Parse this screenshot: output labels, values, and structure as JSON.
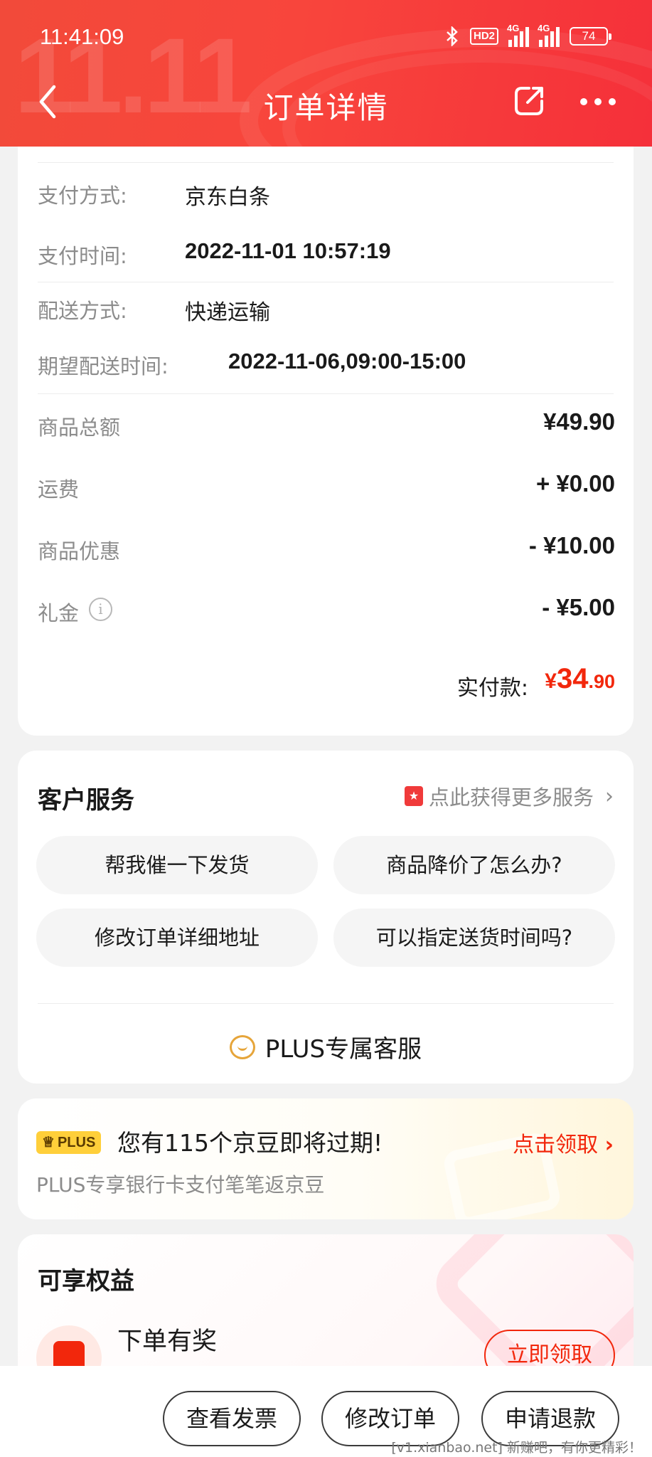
{
  "status_bar": {
    "time": "11:41:09",
    "bluetooth_icon": "bluetooth-icon",
    "hd_label": "HD2",
    "signal1_label": "4G",
    "signal2_label": "4G",
    "battery": "74"
  },
  "header": {
    "title": "订单详情",
    "decor_text": "11.11",
    "back_icon": "chevron-left-icon",
    "share_icon": "share-icon",
    "more_icon": "more-dots-icon"
  },
  "order_info": {
    "rows": [
      {
        "label": "支付方式:",
        "value": "京东白条"
      },
      {
        "label": "支付时间:",
        "value": "2022-11-01 10:57:19"
      },
      {
        "label": "配送方式:",
        "value": "快递运输"
      },
      {
        "label": "期望配送时间:",
        "value": "2022-11-06,09:00-15:00"
      }
    ],
    "amounts": [
      {
        "label": "商品总额",
        "value": "¥49.90"
      },
      {
        "label": "运费",
        "value": "+ ¥0.00"
      },
      {
        "label": "商品优惠",
        "value": "- ¥10.00"
      },
      {
        "label": "礼金",
        "value": "- ¥5.00"
      }
    ],
    "info_glyph": "i",
    "total_label": "实付款:",
    "total_currency": "¥",
    "total_int": "34",
    "total_dec": ".90"
  },
  "service": {
    "title": "客户服务",
    "more_label": "点此获得更多服务",
    "quick_questions": [
      "帮我催一下发货",
      "商品降价了怎么办?",
      "修改订单详细地址",
      "可以指定送货时间吗?"
    ],
    "plus_cs_label": "PLUS专属客服"
  },
  "plus_banner": {
    "badge": "PLUS",
    "headline": "您有115个京豆即将过期!",
    "subline": "PLUS专享银行卡支付笔笔返京豆",
    "cta": "点击领取"
  },
  "benefits": {
    "title": "可享权益",
    "item_name": "下单有奖",
    "claim_label": "立即领取"
  },
  "bottom_bar": {
    "buttons": [
      "查看发票",
      "修改订单",
      "申请退款"
    ]
  },
  "watermark": "[v1.xianbao.net] 新赚吧，有你更精彩！",
  "colors": {
    "header_red": "#f8453c",
    "price_red": "#f2270c",
    "plus_gold": "#ffcf3a"
  }
}
